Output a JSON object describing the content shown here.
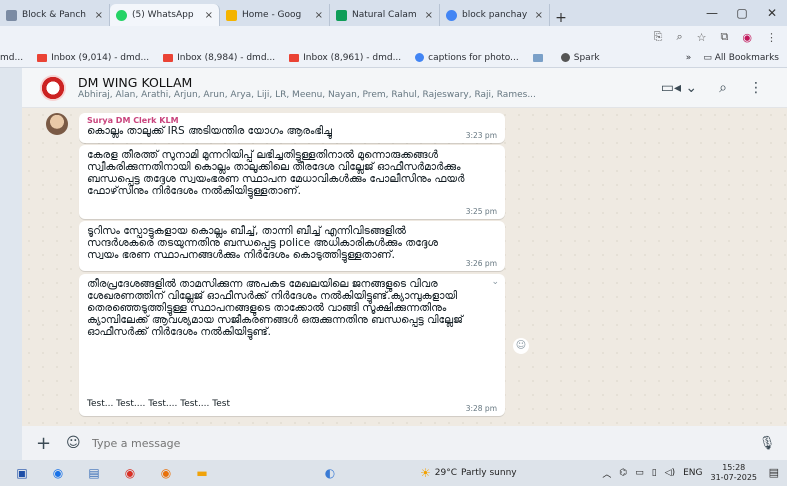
{
  "browser": {
    "tabs": [
      {
        "label": "Block & Panch",
        "color": "#7b8ba3",
        "active": false
      },
      {
        "label": "(5) WhatsApp",
        "color": "#25d366",
        "active": true
      },
      {
        "label": "Home - Goog",
        "color": "#f4b400",
        "active": false
      },
      {
        "label": "Natural Calam",
        "color": "#0f9d58",
        "active": false
      },
      {
        "label": "block panchay",
        "color": "#4285f4",
        "active": false
      }
    ],
    "tab_close": "×",
    "new_tab": "+",
    "bookmarks": [
      {
        "label": "md...",
        "color": "#888"
      },
      {
        "label": "Inbox (9,014) - dmd...",
        "color": "#ea4335"
      },
      {
        "label": "Inbox (8,984) - dmd...",
        "color": "#ea4335"
      },
      {
        "label": "Inbox (8,961) - dmd...",
        "color": "#ea4335"
      },
      {
        "label": "captions for photo...",
        "color": "#4285f4"
      },
      {
        "label": "",
        "color": "#7aa0c8"
      },
      {
        "label": "Spark",
        "color": "#555"
      }
    ],
    "bookmarks_more": "»",
    "all_bookmarks": "All Bookmarks"
  },
  "chat": {
    "group_name": "DM WING KOLLAM",
    "members": "Abhiraj, Alan, Arathi, Arjun, Arun, Arya, Liji, LR, Meenu, Nayan, Prem, Rahul, Rajeswary, Raji, Rames...",
    "messages": [
      {
        "sender": "Surya DM Clerk KLM",
        "text": "കൊല്ലം താലൂക്ക് IRS അടിയന്തിര യോഗം ആരംഭിച്ചു",
        "time": "3:23 pm"
      },
      {
        "sender": "",
        "text": "കേരള തീരത്ത് സുനാമി മുന്നറിയിപ്പ് ലഭിച്ചതിട്ടുള്ളതിനാൽ മുന്നൊരുക്കങ്ങൾ സ്വീകരിക്കുന്നതിനായി കൊല്ലം താലൂക്കിലെ തീരദേശ വില്ലേജ് ഓഫീസർമാർക്കും ബന്ധപ്പെട്ട തദ്ദേശ സ്വയംഭരണ സ്ഥാപന മേധാവികൾക്കും പോലീസിനും ഫയർ ഫോഴ്‌സിനും നിർദേശം നൽകിയിട്ടുള്ളതാണ്.",
        "time": "3:25 pm"
      },
      {
        "sender": "",
        "text": "ടൂറിസം സ്പോട്ടുകളായ കൊല്ലം ബീച്ച്, താന്നി ബീച്ച് എന്നിവിടങ്ങളിൽ സന്ദർശകരെ തടയുന്നതിനു ബന്ധപ്പെട്ട police അധികാരികൾക്കും തദ്ദേശ സ്വയം ഭരണ സ്ഥാപനങ്ങൾക്കും നിർദേശം കൊടുത്തിട്ടുള്ളതാണ്.",
        "time": "3:26 pm"
      },
      {
        "sender": "",
        "text": "തീരപ്രദേശങ്ങളിൽ താമസിക്കുന്ന അപകട മേഖലയിലെ ജനങ്ങളുടെ വിവര ശേഖരണത്തിന് വില്ലേജ് ഓഫീസർക്ക് നിർദേശം നൽകിയിട്ടുണ്ട്.ക്യാമ്പുകളായി തെരഞ്ഞെടുത്തിട്ടുള്ള സ്ഥാപനങ്ങളുടെ താക്കോൽ വാങ്ങി സൂക്ഷിക്കുന്നതിനും ക്യാമ്പിലേക്ക് ആവശ്യമായ സജീകരണങ്ങൾ ഒരുക്കുന്നതിനു ബന്ധപ്പെട്ട വില്ലേജ് ഓഫീസർക്ക് നിർദേശം നൽകിയിട്ടുണ്ട്.",
        "extra": "Test... Test.... Test.... Test.... Test",
        "time": "3:28 pm"
      }
    ],
    "composer_placeholder": "Type a message"
  },
  "taskbar": {
    "weather_temp": "29°C",
    "weather_text": "Partly sunny",
    "language": "ENG",
    "time": "15:28",
    "date": "31-07-2025"
  },
  "colors": {
    "bubble": "#ffffff",
    "chat_bg": "#efeae2",
    "header_bg": "#f4f6f8",
    "sender_color": "#c9437c"
  }
}
